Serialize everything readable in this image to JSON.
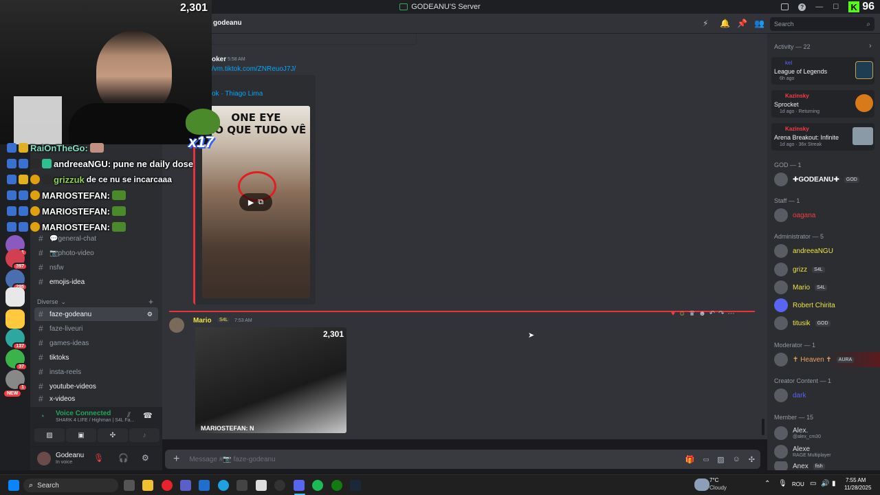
{
  "window": {
    "title": "GODEANU'S Server"
  },
  "titlebar": {
    "kick_count": "96",
    "search_placeholder": "Search"
  },
  "stream": {
    "viewer_count": "2,301",
    "chat": [
      {
        "user": "RaiOnTheGo:",
        "text": "",
        "color": "#7fe0c0"
      },
      {
        "user": "andreeaNGU:",
        "text": "pune ne daily dose",
        "color": "#ffffff"
      },
      {
        "user": "grizzuk",
        "text": "de ce nu se incarcaaa",
        "color": "#8fd14f"
      },
      {
        "user": "MARIOSTEFAN:",
        "text": "",
        "color": "#ffffff"
      },
      {
        "user": "MARIOSTEFAN:",
        "text": "",
        "color": "#ffffff"
      },
      {
        "user": "MARIOSTEFAN:",
        "text": "",
        "color": "#ffffff"
      }
    ],
    "emote_multiplier": "x17"
  },
  "rail": {
    "badges": [
      "114",
      "1",
      "397",
      "295",
      "137",
      "37",
      "1",
      "NEW"
    ]
  },
  "sidebar": {
    "channels_top": [
      {
        "name": "💬general-chat"
      },
      {
        "name": "📷photo-video"
      },
      {
        "name": "nsfw"
      },
      {
        "name": "emojis-idea"
      }
    ],
    "category": "Diverse",
    "channels": [
      {
        "name": "faze-godeanu",
        "active": true
      },
      {
        "name": "faze-liveuri"
      },
      {
        "name": "games-ideas"
      },
      {
        "name": "tiktoks",
        "bold": true
      },
      {
        "name": "insta-reels"
      },
      {
        "name": "youtube-videos",
        "bold": true
      },
      {
        "name": "x-videos",
        "bold": true
      }
    ],
    "voice": {
      "status": "Voice Connected",
      "channel": "SHARK 4 LIFE / Highman | S4L Fa..."
    },
    "user": {
      "name": "Godeanu",
      "status": "In voice"
    }
  },
  "header": {
    "channel": "godeanu"
  },
  "messages": {
    "first": {
      "author": "oker",
      "time": "5:58 AM",
      "link": "/vm.tiktok.com/ZNReuoJ7J/",
      "embed_title": "ok · Thiago Lima",
      "caption": "ONE EYE\nHO QUE TUDO VÊ"
    },
    "second": {
      "author": "Mario",
      "tag": "S4L",
      "time": "7:53 AM",
      "embed_viewers": "2,301",
      "embed_chat": "MARIOSTEFAN: N"
    }
  },
  "composer": {
    "placeholder": "Message #📷 faze-godeanu"
  },
  "members": {
    "activity_header": "Activity — 22",
    "activities": [
      {
        "user": "kel",
        "game": "League of Legends",
        "meta": "6h ago"
      },
      {
        "user": "Kazinsky",
        "game": "Sprocket",
        "meta": "1d ago · Returning"
      },
      {
        "user": "Kazinsky",
        "game": "Arena Breakout: Infinite",
        "meta": "1d ago · 36x Streak"
      }
    ],
    "groups": [
      {
        "title": "GOD — 1",
        "members": [
          {
            "name": "✚GODEANU✚",
            "tag": "GOD",
            "color": "#ffffff"
          }
        ]
      },
      {
        "title": "Staff — 1",
        "members": [
          {
            "name": "oagana",
            "tag": "",
            "color": "#f23f43"
          }
        ]
      },
      {
        "title": "Administrator — 5",
        "members": [
          {
            "name": "andreeaNGU",
            "tag": "",
            "color": "#f0e442"
          },
          {
            "name": "grizz",
            "tag": "S4L",
            "color": "#f0e442"
          },
          {
            "name": "Mario",
            "tag": "S4L",
            "color": "#f0e442"
          },
          {
            "name": "Robert Chirita",
            "tag": "",
            "color": "#f0e442"
          },
          {
            "name": "titusik",
            "tag": "GOD",
            "color": "#f0e442"
          }
        ]
      },
      {
        "title": "Moderator — 1",
        "members": [
          {
            "name": "✝ Heaven ✝",
            "tag": "AURA",
            "color": "#f0a35e"
          }
        ]
      },
      {
        "title": "Creator Content — 1",
        "members": [
          {
            "name": "dark",
            "tag": "",
            "color": "#5865f2"
          }
        ]
      },
      {
        "title": "Member — 15",
        "members": [
          {
            "name": "Alex.",
            "sub": "@alex_cm30",
            "color": "#dbdee1"
          },
          {
            "name": "Alexe",
            "sub": "RAGE Multiplayer",
            "color": "#dbdee1"
          },
          {
            "name": "Anex",
            "tag": "fish",
            "color": "#dbdee1"
          }
        ]
      }
    ]
  },
  "taskbar": {
    "search": "Search",
    "weather_temp": "7°C",
    "weather_desc": "Cloudy",
    "lang": "ROU",
    "time": "7:55 AM",
    "date": "11/28/2025"
  }
}
